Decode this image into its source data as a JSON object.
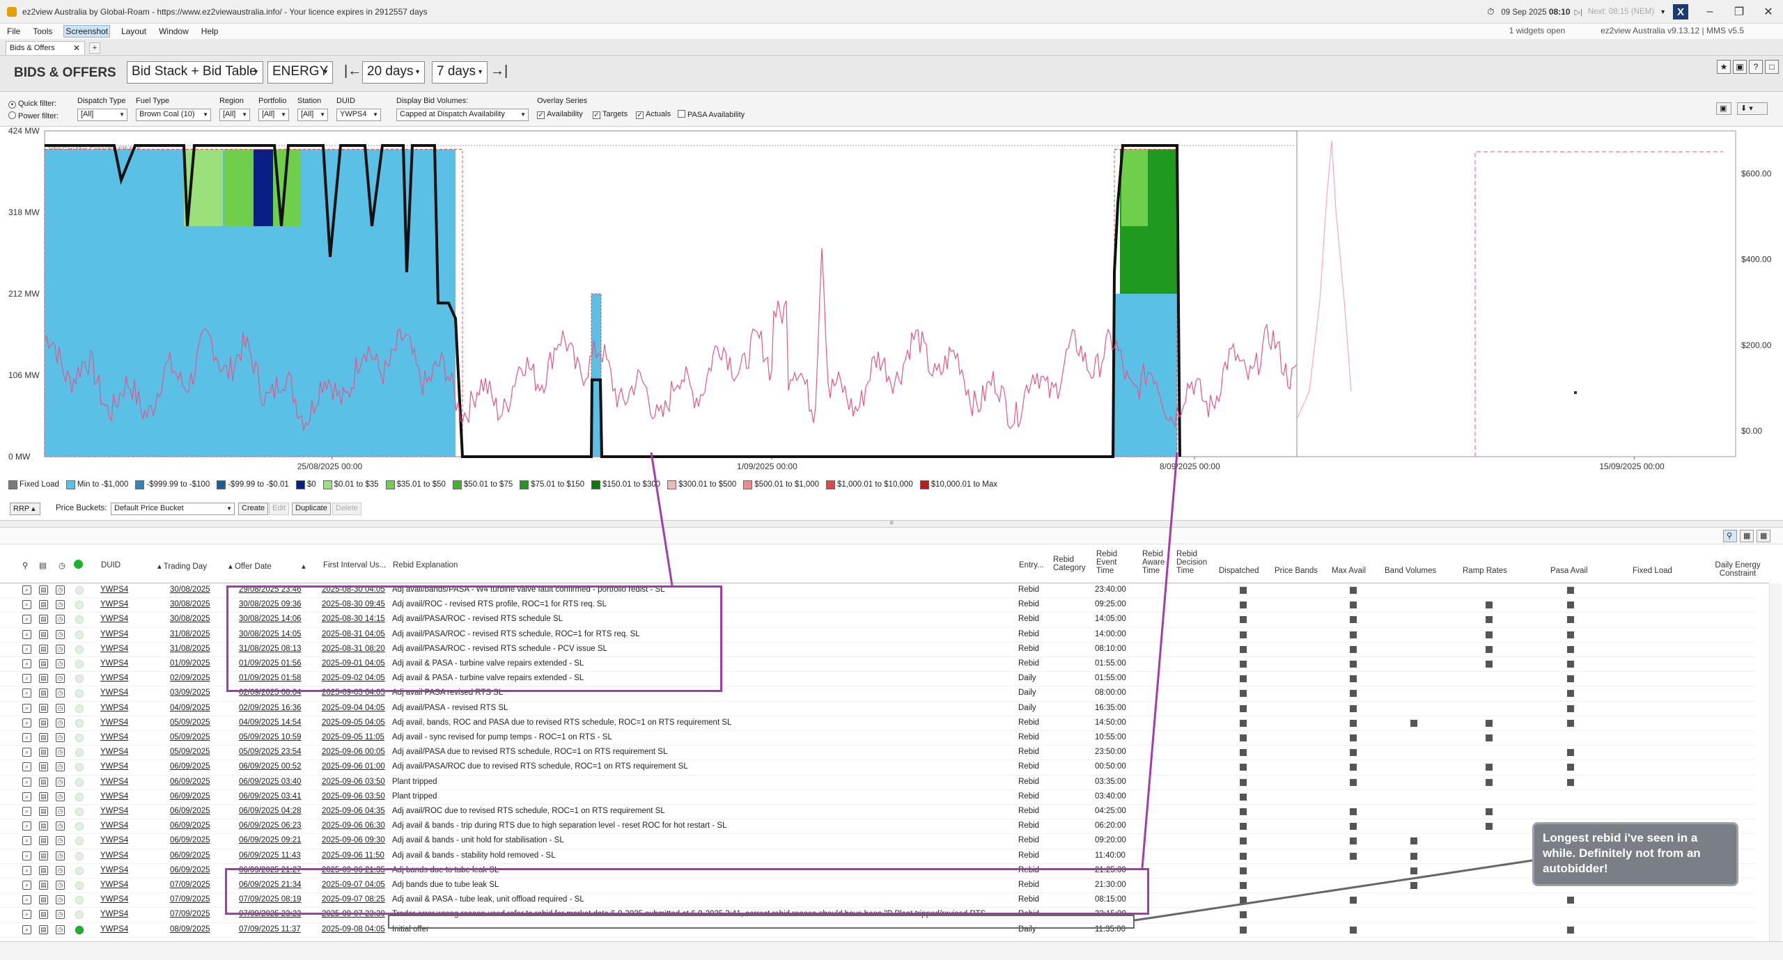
{
  "window": {
    "title": "ez2view Australia by Global-Roam - https://www.ez2viewaustralia.info/ - Your licence expires in 2912557 days",
    "date": "09 Sep 2025",
    "time": "08:10",
    "next": "Next: 08:15 (NEM)",
    "widgets_open": "1 widgets open",
    "version": "ez2view Australia v9.13.12 | MMS v5.5"
  },
  "menu": [
    "File",
    "Tools",
    "Screenshot",
    "Layout",
    "Window",
    "Help"
  ],
  "tab": {
    "label": "Bids & Offers"
  },
  "toolbar": {
    "title": "BIDS & OFFERS",
    "view": "Bid Stack + Bid Table",
    "market": "ENERGY",
    "range1": "20 days",
    "range2": "7 days"
  },
  "filters": {
    "quick": "Quick filter:",
    "power": "Power filter:",
    "dispatch_type_label": "Dispatch Type",
    "dispatch_type": "[All]",
    "fuel_type_label": "Fuel Type",
    "fuel_type": "Brown Coal (10)",
    "region_label": "Region",
    "region": "[All]",
    "portfolio_label": "Portfolio",
    "portfolio": "[All]",
    "station_label": "Station",
    "station": "[All]",
    "duid_label": "DUID",
    "duid": "YWPS4",
    "display_label": "Display Bid Volumes:",
    "display": "Capped at Dispatch Availability",
    "overlay_label": "Overlay Series",
    "overlay": [
      "Availability",
      "Targets",
      "Actuals",
      "PASA Availability"
    ]
  },
  "chart_data": {
    "type": "area",
    "ylabel_ticks": [
      "424 MW",
      "318 MW",
      "212 MW",
      "106 MW",
      "0 MW"
    ],
    "y2_ticks": [
      "$600.00",
      "$400.00",
      "$200.00",
      "$0.00"
    ],
    "xticks": [
      "25/08/2025 00:00",
      "1/09/2025 00:00",
      "8/09/2025 00:00",
      "15/09/2025 00:00"
    ],
    "capacity_label": "Total Gen Max Capacity: 405 MW",
    "ylim": [
      0,
      424
    ],
    "y2lim": [
      -60,
      700
    ],
    "stack_segments": [
      {
        "x0": 0,
        "x1": 0.03,
        "min": 318,
        "zero": 0,
        "mid": 0
      },
      {
        "x0": 0.03,
        "x1": 0.07,
        "min": 380,
        "zero": 0,
        "mid": 0
      },
      {
        "x0": 0.07,
        "x1": 0.2,
        "min": 400,
        "zero": 0,
        "mid": 0
      },
      {
        "x0": 0.2,
        "x1": 0.24,
        "min": 300,
        "zero": 0,
        "mid": 90
      },
      {
        "x0": 0.24,
        "x1": 0.27,
        "min": 300,
        "zero": 80,
        "mid": 20
      },
      {
        "x0": 0.27,
        "x1": 0.3,
        "min": 290,
        "zero": 0,
        "mid": 100
      },
      {
        "x0": 0.3,
        "x1": 0.36,
        "min": 300,
        "zero": 0,
        "mid": 100
      },
      {
        "x0": 0.36,
        "x1": 0.4,
        "min": 400,
        "zero": 0,
        "mid": 0
      }
    ],
    "legend": [
      {
        "name": "Fixed Load",
        "color": "#7a7a7a"
      },
      {
        "name": "Min to -$1,000",
        "color": "#5bc0e6"
      },
      {
        "name": "-$999.99 to -$100",
        "color": "#2e86c1"
      },
      {
        "name": "-$99.99 to -$0.01",
        "color": "#1f5c99"
      },
      {
        "name": "$0",
        "color": "#0a1f85"
      },
      {
        "name": "$0.01 to $35",
        "color": "#9be07a"
      },
      {
        "name": "$35.01 to $50",
        "color": "#6fcf4a"
      },
      {
        "name": "$50.01 to $75",
        "color": "#3fb52c"
      },
      {
        "name": "$75.01 to $150",
        "color": "#1f9a1f"
      },
      {
        "name": "$150.01 to $300",
        "color": "#0c7a10"
      },
      {
        "name": "$300.01 to $500",
        "color": "#f4b6b6"
      },
      {
        "name": "$500.01 to $1,000",
        "color": "#f08a8a"
      },
      {
        "name": "$1,000.01 to $10,000",
        "color": "#e04848"
      },
      {
        "name": "$10,000.01 to Max",
        "color": "#b51c1c"
      }
    ]
  },
  "price_bar": {
    "rrp": "RRP",
    "buckets_label": "Price Buckets:",
    "bucket": "Default Price Bucket",
    "create": "Create",
    "edit": "Edit",
    "duplicate": "Duplicate",
    "delete": "Delete"
  },
  "columns": {
    "duid": "DUID",
    "trading_day": "Trading Day",
    "offer_date": "Offer Date",
    "first_interval": "First Interval Us...",
    "explanation": "Rebid Explanation",
    "entry": "Entry...",
    "category": "Rebid Category",
    "event_time": "Rebid Event Time",
    "aware_time": "Rebid Aware Time",
    "decision_time": "Rebid Decision Time",
    "dispatched": "Dispatched",
    "price_bands": "Price Bands",
    "max_avail": "Max Avail",
    "band_volumes": "Band Volumes",
    "ramp_rates": "Ramp Rates",
    "pasa_avail": "Pasa Avail",
    "fixed_load": "Fixed Load",
    "daily_energy": "Daily Energy Constraint"
  },
  "rows": [
    {
      "duid": "YWPS4",
      "day": "30/08/2025",
      "offer": "29/08/2025 23:46",
      "first": "2025-08-30 04:05",
      "exp": "Adj avail/bands/PASA - W4 turbine valve fault confirmed - portfolio redist - SL",
      "entry": "Rebid",
      "event": "23:40:00",
      "f": [
        1,
        0,
        1,
        0,
        0,
        1
      ]
    },
    {
      "duid": "YWPS4",
      "day": "30/08/2025",
      "offer": "30/08/2025 09:36",
      "first": "2025-08-30 09:45",
      "exp": "Adj avail/ROC - revised RTS profile, ROC=1 for RTS req. SL",
      "entry": "Rebid",
      "event": "09:25:00",
      "f": [
        1,
        0,
        1,
        0,
        1,
        1
      ]
    },
    {
      "duid": "YWPS4",
      "day": "30/08/2025",
      "offer": "30/08/2025 14:06",
      "first": "2025-08-30 14:15",
      "exp": "Adj avail/PASA/ROC - revised RTS schedule SL",
      "entry": "Rebid",
      "event": "14:05:00",
      "f": [
        1,
        0,
        1,
        0,
        1,
        1
      ]
    },
    {
      "duid": "YWPS4",
      "day": "31/08/2025",
      "offer": "30/08/2025 14:05",
      "first": "2025-08-31 04:05",
      "exp": "Adj avail/PASA/ROC - revised RTS schedule, ROC=1 for RTS req. SL",
      "entry": "Rebid",
      "event": "14:00:00",
      "f": [
        1,
        0,
        1,
        0,
        1,
        1
      ]
    },
    {
      "duid": "YWPS4",
      "day": "31/08/2025",
      "offer": "31/08/2025 08:13",
      "first": "2025-08-31 08:20",
      "exp": "Adj avail/PASA/ROC - revised RTS schedule - PCV issue SL",
      "entry": "Rebid",
      "event": "08:10:00",
      "f": [
        1,
        0,
        1,
        0,
        1,
        1
      ]
    },
    {
      "duid": "YWPS4",
      "day": "01/09/2025",
      "offer": "01/09/2025 01:56",
      "first": "2025-09-01 04:05",
      "exp": "Adj avail & PASA - turbine valve repairs extended - SL",
      "entry": "Rebid",
      "event": "01:55:00",
      "f": [
        1,
        0,
        1,
        0,
        1,
        1
      ]
    },
    {
      "duid": "YWPS4",
      "day": "02/09/2025",
      "offer": "01/09/2025 01:58",
      "first": "2025-09-02 04:05",
      "exp": "Adj avail & PASA - turbine valve repairs extended - SL",
      "entry": "Daily",
      "event": "01:55:00",
      "f": [
        1,
        0,
        1,
        0,
        0,
        1
      ]
    },
    {
      "duid": "YWPS4",
      "day": "03/09/2025",
      "offer": "02/09/2025 08:04",
      "first": "2025-09-03 04:05",
      "exp": "Adj avail PASA revised RTS SL",
      "entry": "Daily",
      "event": "08:00:00",
      "f": [
        1,
        0,
        1,
        0,
        0,
        1
      ]
    },
    {
      "duid": "YWPS4",
      "day": "04/09/2025",
      "offer": "02/09/2025 16:36",
      "first": "2025-09-04 04:05",
      "exp": "Adj avail/PASA - revised RTS SL",
      "entry": "Daily",
      "event": "16:35:00",
      "f": [
        1,
        0,
        1,
        0,
        0,
        1
      ]
    },
    {
      "duid": "YWPS4",
      "day": "05/09/2025",
      "offer": "04/09/2025 14:54",
      "first": "2025-09-05 04:05",
      "exp": "Adj avail, bands, ROC and PASA due to revised RTS schedule, ROC=1 on RTS requirement SL",
      "entry": "Rebid",
      "event": "14:50:00",
      "f": [
        1,
        0,
        1,
        1,
        1,
        1
      ]
    },
    {
      "duid": "YWPS4",
      "day": "05/09/2025",
      "offer": "05/09/2025 10:59",
      "first": "2025-09-05 11:05",
      "exp": "Adj avail - sync revised for pump temps - ROC=1 on RTS - SL",
      "entry": "Rebid",
      "event": "10:55:00",
      "f": [
        1,
        0,
        1,
        0,
        1,
        0
      ]
    },
    {
      "duid": "YWPS4",
      "day": "05/09/2025",
      "offer": "05/09/2025 23:54",
      "first": "2025-09-06 00:05",
      "exp": "Adj avail/PASA due to revised RTS schedule, ROC=1 on RTS requirement SL",
      "entry": "Rebid",
      "event": "23:50:00",
      "f": [
        1,
        0,
        1,
        0,
        0,
        1
      ]
    },
    {
      "duid": "YWPS4",
      "day": "06/09/2025",
      "offer": "06/09/2025 00:52",
      "first": "2025-09-06 01:00",
      "exp": "Adj avail/PASA/ROC due to revised RTS schedule, ROC=1 on RTS requirement SL",
      "entry": "Rebid",
      "event": "00:50:00",
      "f": [
        1,
        0,
        1,
        0,
        1,
        1
      ]
    },
    {
      "duid": "YWPS4",
      "day": "06/09/2025",
      "offer": "06/09/2025 03:40",
      "first": "2025-09-06 03:50",
      "exp": "Plant tripped",
      "entry": "Rebid",
      "event": "03:35:00",
      "f": [
        1,
        0,
        1,
        0,
        1,
        1
      ]
    },
    {
      "duid": "YWPS4",
      "day": "06/09/2025",
      "offer": "06/09/2025 03:41",
      "first": "2025-09-06 03:50",
      "exp": "Plant tripped",
      "entry": "Rebid",
      "event": "03:40:00",
      "f": [
        1,
        0,
        0,
        0,
        0,
        0
      ]
    },
    {
      "duid": "YWPS4",
      "day": "06/09/2025",
      "offer": "06/09/2025 04:28",
      "first": "2025-09-06 04:35",
      "exp": "Adj avail/ROC due to revised RTS schedule, ROC=1 on RTS requirement SL",
      "entry": "Rebid",
      "event": "04:25:00",
      "f": [
        1,
        0,
        1,
        0,
        1,
        0
      ]
    },
    {
      "duid": "YWPS4",
      "day": "06/09/2025",
      "offer": "06/09/2025 06:23",
      "first": "2025-09-06 06:30",
      "exp": "Adj avail & bands - trip during RTS due to high separation level - reset ROC for hot restart - SL",
      "entry": "Rebid",
      "event": "06:20:00",
      "f": [
        1,
        0,
        1,
        0,
        1,
        0
      ]
    },
    {
      "duid": "YWPS4",
      "day": "06/09/2025",
      "offer": "06/09/2025 09:21",
      "first": "2025-09-06 09:30",
      "exp": "Adj avail & bands - unit hold for stabilisation - SL",
      "entry": "Rebid",
      "event": "09:20:00",
      "f": [
        1,
        0,
        1,
        1,
        0,
        0
      ]
    },
    {
      "duid": "YWPS4",
      "day": "06/09/2025",
      "offer": "06/09/2025 11:43",
      "first": "2025-09-06 11:50",
      "exp": "Adj avail & bands - stability hold removed - SL",
      "entry": "Rebid",
      "event": "11:40:00",
      "f": [
        1,
        0,
        1,
        1,
        0,
        0
      ]
    },
    {
      "duid": "YWPS4",
      "day": "06/09/2025",
      "offer": "06/09/2025 21:27",
      "first": "2025-09-06 21:35",
      "exp": "Adj bands due to tube leak SL",
      "entry": "Rebid",
      "event": "21:25:00",
      "f": [
        1,
        0,
        0,
        1,
        0,
        0
      ]
    },
    {
      "duid": "YWPS4",
      "day": "07/09/2025",
      "offer": "06/09/2025 21:34",
      "first": "2025-09-07 04:05",
      "exp": "Adj bands due to tube leak SL",
      "entry": "Rebid",
      "event": "21:30:00",
      "f": [
        1,
        0,
        0,
        1,
        0,
        0
      ]
    },
    {
      "duid": "YWPS4",
      "day": "07/09/2025",
      "offer": "07/09/2025 08:19",
      "first": "2025-09-07 08:25",
      "exp": "Adj avail & PASA - tube leak, unit offload required - SL",
      "entry": "Rebid",
      "event": "08:15:00",
      "f": [
        1,
        0,
        1,
        0,
        0,
        1
      ]
    },
    {
      "duid": "YWPS4",
      "day": "07/09/2025",
      "offer": "07/09/2025 23:23",
      "first": "2025-09-07 23:30",
      "exp": "Trader error wrong reason used refer to rebid for market date 6-9-2025 submitted at 6-9-2025 3:41, correct rebid reason should have been \"P Plant tripped/revised RTS...",
      "entry": "Rebid",
      "event": "23:15:00",
      "f": [
        1,
        0,
        0,
        0,
        0,
        0
      ]
    },
    {
      "duid": "YWPS4",
      "day": "08/09/2025",
      "offer": "07/09/2025 11:37",
      "first": "2025-09-08 04:05",
      "exp": "Initial offer",
      "entry": "Daily",
      "event": "11:35:00",
      "f": [
        1,
        0,
        1,
        0,
        0,
        1
      ]
    }
  ],
  "callout": "Longest rebid i've seen in a while.  Definitely not from an autobidder!"
}
